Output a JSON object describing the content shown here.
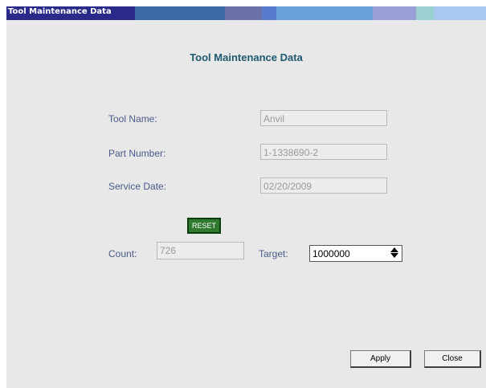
{
  "window": {
    "title": "Tool Maintenance Data",
    "titlebar_colors": [
      "#2a2a8a",
      "#3c6aa8",
      "#6a70a8",
      "#5a7ad0",
      "#6aa0d8",
      "#9aa0d8",
      "#9ad0d0",
      "#a8c8f0"
    ]
  },
  "heading": "Tool Maintenance Data",
  "fields": {
    "tool_name": {
      "label": "Tool Name:",
      "value": "Anvil"
    },
    "part_number": {
      "label": "Part Number:",
      "value": "1-1338690-2"
    },
    "service_date": {
      "label": "Service Date:",
      "value": "02/20/2009"
    }
  },
  "reset_label": "RESET",
  "count": {
    "label": "Count:",
    "value": "726"
  },
  "target": {
    "label": "Target:",
    "value": "1000000"
  },
  "buttons": {
    "apply": "Apply",
    "close": "Close"
  }
}
